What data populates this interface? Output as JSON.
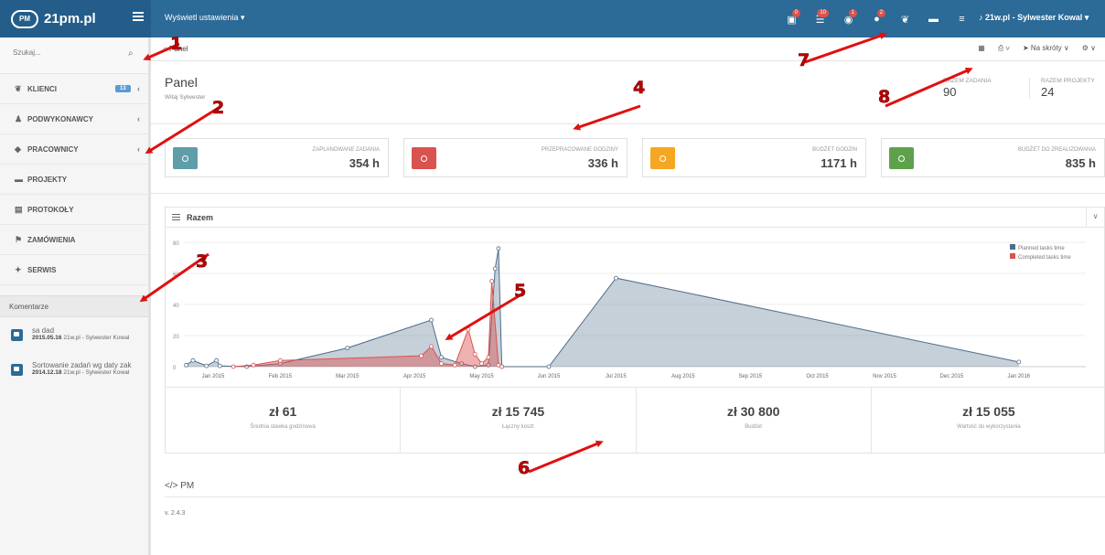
{
  "app": {
    "brand": "21pm.pl",
    "logo_text": "PM"
  },
  "topbar": {
    "settings_menu": "Wyświetl ustawienia ▾",
    "icons": [
      {
        "name": "folder-badge-icon",
        "glyph": "▣",
        "badge": "0"
      },
      {
        "name": "tasks-badge-icon",
        "glyph": "☰",
        "badge": "10"
      },
      {
        "name": "eye-badge-icon",
        "glyph": "◉",
        "badge": "1"
      },
      {
        "name": "comments-badge-icon",
        "glyph": "●",
        "badge": "2"
      },
      {
        "name": "users-icon",
        "glyph": "❦",
        "badge": ""
      },
      {
        "name": "folder-icon",
        "glyph": "▬",
        "badge": ""
      },
      {
        "name": "list-icon",
        "glyph": "≡",
        "badge": ""
      }
    ],
    "user": "♪ 21w.pl - Sylwester Kowal ▾"
  },
  "breadcrumb": {
    "home": "⌂ Panel",
    "calendar": "▦",
    "print": "⎙ ∨",
    "shortcuts": "➤ Na skróty ∨",
    "settings": "⚙ ∨"
  },
  "sidebar": {
    "search_placeholder": "Szukaj...",
    "search_icon": "⌕",
    "items": [
      {
        "id": "klienci",
        "label": "KLIENCI",
        "icon": "❦",
        "count": "13",
        "chev": "‹"
      },
      {
        "id": "podwykonawcy",
        "label": "PODWYKONAWCY",
        "icon": "♟",
        "count": "",
        "chev": "‹"
      },
      {
        "id": "pracownicy",
        "label": "PRACOWNICY",
        "icon": "◆",
        "count": "",
        "chev": "‹"
      },
      {
        "id": "projekty",
        "label": "PROJEKTY",
        "icon": "▬",
        "count": "",
        "chev": ""
      },
      {
        "id": "protokoly",
        "label": "PROTOKOŁY",
        "icon": "▤",
        "count": "",
        "chev": ""
      },
      {
        "id": "zamowienia",
        "label": "ZAMÓWIENIA",
        "icon": "⚑",
        "count": "",
        "chev": ""
      },
      {
        "id": "serwis",
        "label": "SERWIS",
        "icon": "✦",
        "count": "",
        "chev": ""
      }
    ],
    "comments_header": "Komentarze",
    "comments": [
      {
        "title": "sa dad",
        "date": "2015.05.16",
        "author": "21w.pl - Sylwester Kowal"
      },
      {
        "title": "Sortowanie zadań wg daty zak",
        "date": "2014.12.18",
        "author": "21w.pl - Sylwester Kowal"
      }
    ]
  },
  "header": {
    "title": "Panel",
    "subtitle": "Witaj Sylwester",
    "stats": [
      {
        "label": "RAZEM ZADANIA",
        "value": "90"
      },
      {
        "label": "RAZEM PROJEKTY",
        "value": "24"
      }
    ]
  },
  "kpis": [
    {
      "label": "ZAPLANOWANE ZADANIA",
      "value": "354 h",
      "color": "#5f9ea8"
    },
    {
      "label": "PRZEPRACOWANE GODZINY",
      "value": "336 h",
      "color": "#d9534f"
    },
    {
      "label": "BUDŻET GODZIN",
      "value": "1171 h",
      "color": "#f5a623"
    },
    {
      "label": "BUDŻET DO ZREALIZOWANIA",
      "value": "835 h",
      "color": "#5da24b"
    }
  ],
  "chart_panel": {
    "title": "Razem",
    "collapse": "∨"
  },
  "chart_data": {
    "type": "area",
    "x_labels": [
      "Jan 2015",
      "Feb 2015",
      "Mar 2015",
      "Apr 2015",
      "May 2015",
      "Jun 2015",
      "Jul 2015",
      "Aug 2015",
      "Sep 2015",
      "Oct 2015",
      "Nov 2015",
      "Dec 2015",
      "Jan 2016"
    ],
    "y_ticks": [
      0,
      20,
      40,
      60,
      80
    ],
    "ylim": [
      0,
      80
    ],
    "legend_position": "top-right",
    "series": [
      {
        "name": "Planned tasks time",
        "color": "#4f6d8a",
        "points": [
          [
            -0.4,
            1
          ],
          [
            -0.3,
            4
          ],
          [
            -0.1,
            0.5
          ],
          [
            0.05,
            4
          ],
          [
            0.1,
            0.5
          ],
          [
            0.5,
            0
          ],
          [
            1,
            2
          ],
          [
            2,
            12
          ],
          [
            3.25,
            30
          ],
          [
            3.4,
            6
          ],
          [
            3.7,
            2
          ],
          [
            3.9,
            0
          ],
          [
            4.1,
            1
          ],
          [
            4.2,
            63
          ],
          [
            4.25,
            76
          ],
          [
            4.3,
            0
          ],
          [
            5,
            0
          ],
          [
            6,
            57
          ],
          [
            12,
            3
          ]
        ]
      },
      {
        "name": "Completed tasks time",
        "color": "#d9534f",
        "points": [
          [
            0.3,
            0
          ],
          [
            0.6,
            1
          ],
          [
            1,
            4
          ],
          [
            3.1,
            7
          ],
          [
            3.25,
            13
          ],
          [
            3.4,
            2
          ],
          [
            3.6,
            1
          ],
          [
            3.8,
            24
          ],
          [
            3.9,
            8
          ],
          [
            4.0,
            2
          ],
          [
            4.1,
            6
          ],
          [
            4.15,
            55
          ],
          [
            4.25,
            1
          ],
          [
            4.3,
            0
          ]
        ]
      }
    ]
  },
  "summary": [
    {
      "value": "zł 61",
      "label": "Średnia stawka godzinowa"
    },
    {
      "value": "zł 15 745",
      "label": "Łączny koszt"
    },
    {
      "value": "zł 30 800",
      "label": "Budżet"
    },
    {
      "value": "zł 15 055",
      "label": "Wartość do wykorzystania"
    }
  ],
  "footer": {
    "title": "</> PM",
    "version": "v. 2.4.3"
  },
  "callouts": [
    "1",
    "2",
    "3",
    "4",
    "5",
    "6",
    "7",
    "8"
  ]
}
